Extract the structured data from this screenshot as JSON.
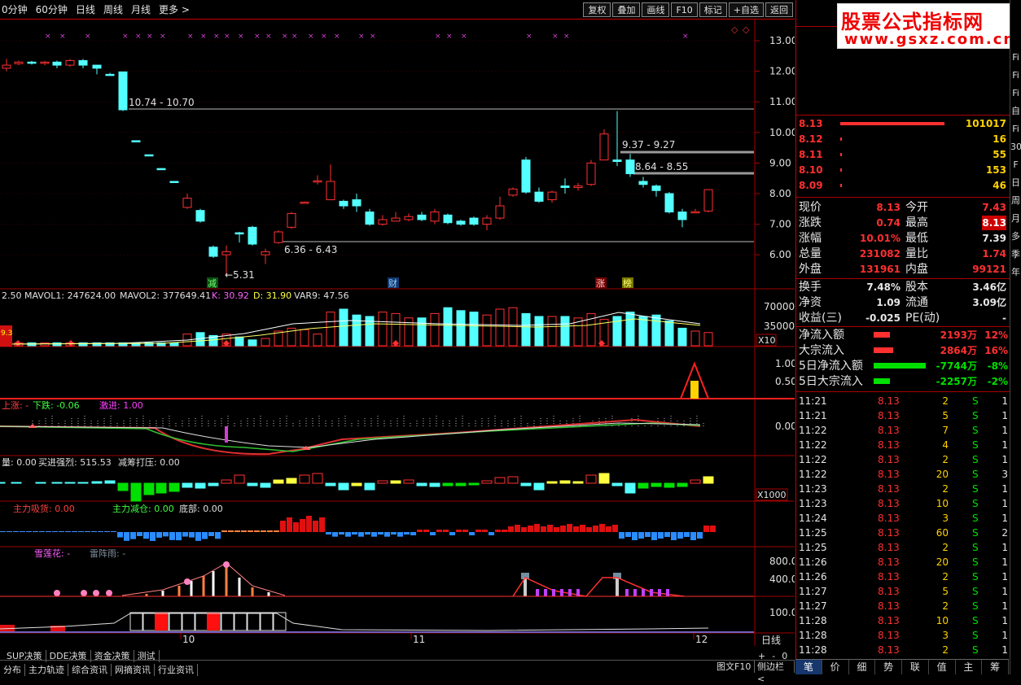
{
  "topbar": {
    "periods": [
      "0分钟",
      "60分钟",
      "日线",
      "周线",
      "月线",
      "更多"
    ],
    "more_arrow": ">",
    "buttons": [
      "复权",
      "叠加",
      "画线",
      "F10",
      "标记",
      "+自选",
      "返回"
    ]
  },
  "logo": {
    "title": "股票公式指标网",
    "url": "www.gsxz.com.cn"
  },
  "price_axis": [
    "13.00",
    "12.00",
    "11.00",
    "10.00",
    "9.00",
    "8.00",
    "7.00",
    "6.00"
  ],
  "annotations": {
    "range1": "10.74 - 10.70",
    "range2": "9.37 - 9.27",
    "range3": "8.64 - 8.55",
    "range4": "6.36 - 6.43",
    "low": "←5.31",
    "tags": [
      "减",
      "财",
      "涨",
      "榜"
    ]
  },
  "vol_header": {
    "a": "2.50",
    "mavol1": "MAVOL1: 247624.00",
    "mavol2": "MAVOL2: 377649.41",
    "k": "K: 30.92",
    "d": "D: 31.90",
    "var9": "VAR9: 47.56"
  },
  "vol_axis": [
    "70000",
    "35000",
    "X10"
  ],
  "ind1_axis": [
    "1.00",
    "0.50"
  ],
  "ind2": {
    "up": "上涨: -",
    "down": "下跌: -0.06",
    "jj": "激进: 1.00",
    "axis": "0.00"
  },
  "ind3": {
    "a": "量: 0.00",
    "b": "买进强烈: 515.53",
    "c": "减筹打压: 0.00",
    "axis": "X1000"
  },
  "ind4": {
    "a": "主力吸货: 0.00",
    "b": "主力减仓: 0.00",
    "c": "底部: 0.00"
  },
  "ind5": {
    "a": "雪莲花: -",
    "b": "雷阵雨: -",
    "axis": [
      "800.0",
      "400.0"
    ]
  },
  "ind6": {
    "axis": "100.0"
  },
  "xaxis": [
    "10",
    "11",
    "12"
  ],
  "left_badge": "9.3",
  "orderbook": [
    {
      "p": "8.13",
      "v": "101017",
      "bar": 128
    },
    {
      "p": "8.12",
      "v": "16",
      "bar": 2
    },
    {
      "p": "8.11",
      "v": "55",
      "bar": 2
    },
    {
      "p": "8.10",
      "v": "153",
      "bar": 2
    },
    {
      "p": "8.09",
      "v": "46",
      "bar": 2
    }
  ],
  "quote": [
    [
      "现价",
      "8.13",
      "今开",
      "7.43"
    ],
    [
      "涨跌",
      "0.74",
      "最高",
      "8.13"
    ],
    [
      "涨幅",
      "10.01%",
      "最低",
      "7.39"
    ],
    [
      "总量",
      "231082",
      "量比",
      "1.74"
    ],
    [
      "外盘",
      "131961",
      "内盘",
      "99121"
    ]
  ],
  "quote2": [
    [
      "换手",
      "7.48%",
      "股本",
      "3.46亿"
    ],
    [
      "净资",
      "1.09",
      "流通",
      "3.09亿"
    ],
    [
      "收益(三)",
      "-0.025",
      "PE(动)",
      "-"
    ]
  ],
  "flows": [
    {
      "l": "净流入额",
      "v": "2193万",
      "p": "12%",
      "c": "#ff3030",
      "w": 20
    },
    {
      "l": "大宗流入",
      "v": "2864万",
      "p": "16%",
      "c": "#ff3030",
      "w": 24
    },
    {
      "l": "5日净流入额",
      "v": "-7744万",
      "p": "-8%",
      "c": "#00e000",
      "w": 64
    },
    {
      "l": "5日大宗流入",
      "v": "-2257万",
      "p": "-2%",
      "c": "#00e000",
      "w": 20
    }
  ],
  "ticks": [
    [
      "11:21",
      "8.13",
      "2",
      "S",
      "1"
    ],
    [
      "11:21",
      "8.13",
      "5",
      "S",
      "1"
    ],
    [
      "11:22",
      "8.13",
      "7",
      "S",
      "1"
    ],
    [
      "11:22",
      "8.13",
      "4",
      "S",
      "1"
    ],
    [
      "11:22",
      "8.13",
      "2",
      "S",
      "1"
    ],
    [
      "11:22",
      "8.13",
      "20",
      "S",
      "3"
    ],
    [
      "11:23",
      "8.13",
      "2",
      "S",
      "1"
    ],
    [
      "11:23",
      "8.13",
      "10",
      "S",
      "1"
    ],
    [
      "11:24",
      "8.13",
      "3",
      "S",
      "1"
    ],
    [
      "11:25",
      "8.13",
      "60",
      "S",
      "2"
    ],
    [
      "11:25",
      "8.13",
      "2",
      "S",
      "1"
    ],
    [
      "11:26",
      "8.13",
      "20",
      "S",
      "1"
    ],
    [
      "11:26",
      "8.13",
      "2",
      "S",
      "1"
    ],
    [
      "11:27",
      "8.13",
      "5",
      "S",
      "1"
    ],
    [
      "11:27",
      "8.13",
      "2",
      "S",
      "1"
    ],
    [
      "11:28",
      "8.13",
      "10",
      "S",
      "1"
    ],
    [
      "11:28",
      "8.13",
      "3",
      "S",
      "1"
    ],
    [
      "11:28",
      "8.13",
      "2",
      "S",
      "1"
    ]
  ],
  "rstrip": [
    "Fi",
    "Fi",
    "Fi",
    "自",
    "Fi",
    "30",
    "F",
    "日",
    "周",
    "月",
    "多",
    "季",
    "年"
  ],
  "bottom_tabs1": [
    "SUP决策",
    "DDE决策",
    "资金决策",
    "测试"
  ],
  "bottom_tabs2": [
    "分布",
    "主力轨迹",
    "综合资讯",
    "网摘资讯",
    "行业资讯"
  ],
  "bottom_right1": [
    "+",
    "-",
    "0"
  ],
  "bottom_right2": [
    "图文F10",
    "侧边栏<",
    "日线"
  ],
  "rb_tabs": [
    "笔",
    "价",
    "细",
    "势",
    "联",
    "值",
    "主",
    "筹"
  ],
  "candles": [
    [
      0,
      0,
      0,
      0
    ],
    [
      1,
      12.1,
      12.15,
      12.4,
      12.0
    ],
    [
      2,
      12.2,
      12.3,
      12.35,
      12.15
    ],
    [
      3,
      12.3,
      12.25,
      12.35,
      12.2
    ],
    [
      4,
      12.25,
      12.3,
      12.35,
      12.2
    ],
    [
      5,
      12.3,
      12.2,
      12.35,
      12.1
    ],
    [
      6,
      12.2,
      12.4,
      12.45,
      12.15
    ],
    [
      7,
      12.3,
      12.2,
      12.4,
      12.1
    ],
    [
      8,
      12.2,
      11.9,
      12.2,
      11.8
    ],
    [
      9,
      11.9,
      11.85,
      11.95,
      11.8
    ],
    [
      10,
      11.9,
      10.7,
      11.9,
      10.7
    ]
  ]
}
